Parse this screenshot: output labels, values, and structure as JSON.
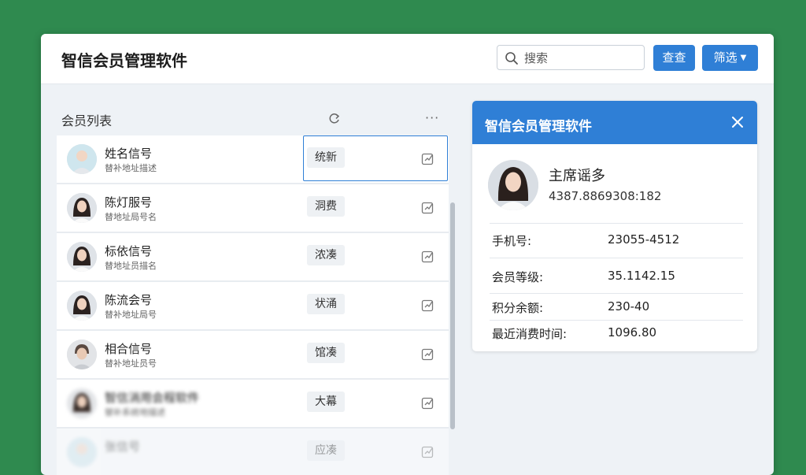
{
  "app": {
    "title": "智信会员管理软件"
  },
  "toolbar": {
    "search_placeholder": "搜索",
    "query_label": "查查",
    "filter_label": "筛选",
    "caret": "▼"
  },
  "list": {
    "title": "会员列表",
    "more": "···",
    "rows": [
      {
        "name": "姓名信号",
        "sub": "替补地址描述",
        "tag": "统新"
      },
      {
        "name": "陈灯服号",
        "sub": "替地址局号名",
        "tag": "洞费"
      },
      {
        "name": "标依信号",
        "sub": "替地址员描名",
        "tag": "浓凑"
      },
      {
        "name": "陈流会号",
        "sub": "替补地址局号",
        "tag": "状涌"
      },
      {
        "name": "相合信号",
        "sub": "替补地址员号",
        "tag": "馆凑"
      },
      {
        "name": "智信消用会程软件",
        "sub": "替补系统地描述",
        "tag": "大幕"
      },
      {
        "name": "张信号",
        "sub": "",
        "tag": "应凑"
      }
    ]
  },
  "detail": {
    "title": "智信会员管理软件",
    "name": "主席谣多",
    "id": "4387.8869308:182",
    "fields": [
      {
        "label": "手机号:",
        "value": "23055-4512"
      },
      {
        "label": "会员等级:",
        "value": "35.1142.15"
      },
      {
        "label": "积分余额:",
        "value": "230-40"
      },
      {
        "label": "最近消费时间:",
        "value": "1096.80"
      }
    ]
  },
  "colors": {
    "background": "#2f8a4f",
    "accent": "#2f7fd6",
    "panel": "#eef2f6"
  }
}
